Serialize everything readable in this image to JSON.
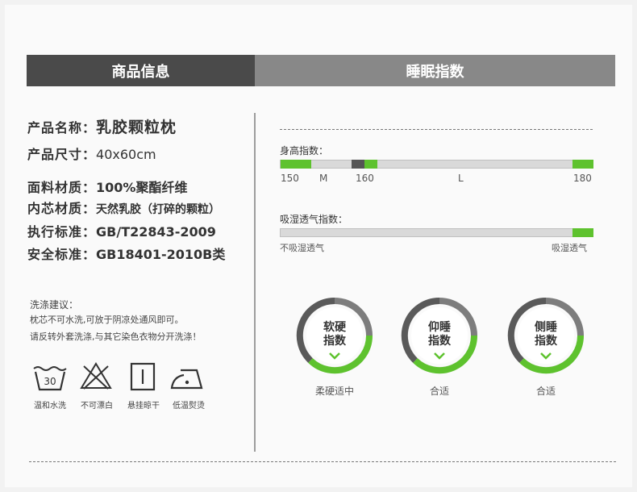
{
  "headers": {
    "left": "商品信息",
    "right": "睡眠指数"
  },
  "info": [
    {
      "label": "产品名称：",
      "value": "乳胶颗粒枕"
    },
    {
      "label": "产品尺寸：",
      "value": "40x60cm"
    },
    {
      "label": "面料材质：",
      "value": "100%聚酯纤维"
    },
    {
      "label": "内芯材质：",
      "value": "天然乳胶（打碎的颗粒）"
    },
    {
      "label": "执行标准：",
      "value": "GB/T22843-2009"
    },
    {
      "label": "安全标准：",
      "value": "GB18401-2010B类"
    }
  ],
  "care": {
    "title": "洗涤建议：",
    "lines": [
      "枕芯不可水洗,可放于阴凉处通风即可。",
      "请反转外套洗涤,与其它染色衣物分开洗涤！"
    ],
    "icons": [
      {
        "icon": "wash-30-icon",
        "text": "30",
        "label": "温和水洗"
      },
      {
        "icon": "no-bleach-icon",
        "label": "不可漂白"
      },
      {
        "icon": "hang-dry-icon",
        "label": "悬挂晾干"
      },
      {
        "icon": "low-iron-icon",
        "label": "低温熨烫"
      }
    ]
  },
  "height_index": {
    "title": "身高指数：",
    "ticks": [
      "150",
      "M",
      "160",
      "L",
      "180"
    ]
  },
  "breath_index": {
    "title": "吸湿透气指数：",
    "left_label": "不吸湿透气",
    "right_label": "吸湿透气"
  },
  "dials": [
    {
      "line1": "软硬",
      "line2": "指数",
      "label": "柔硬适中"
    },
    {
      "line1": "仰睡",
      "line2": "指数",
      "label": "合适"
    },
    {
      "line1": "侧睡",
      "line2": "指数",
      "label": "合适"
    }
  ],
  "colors": {
    "green": "#5ec22e",
    "dark": "#4a4a4a",
    "mid": "#888888"
  }
}
